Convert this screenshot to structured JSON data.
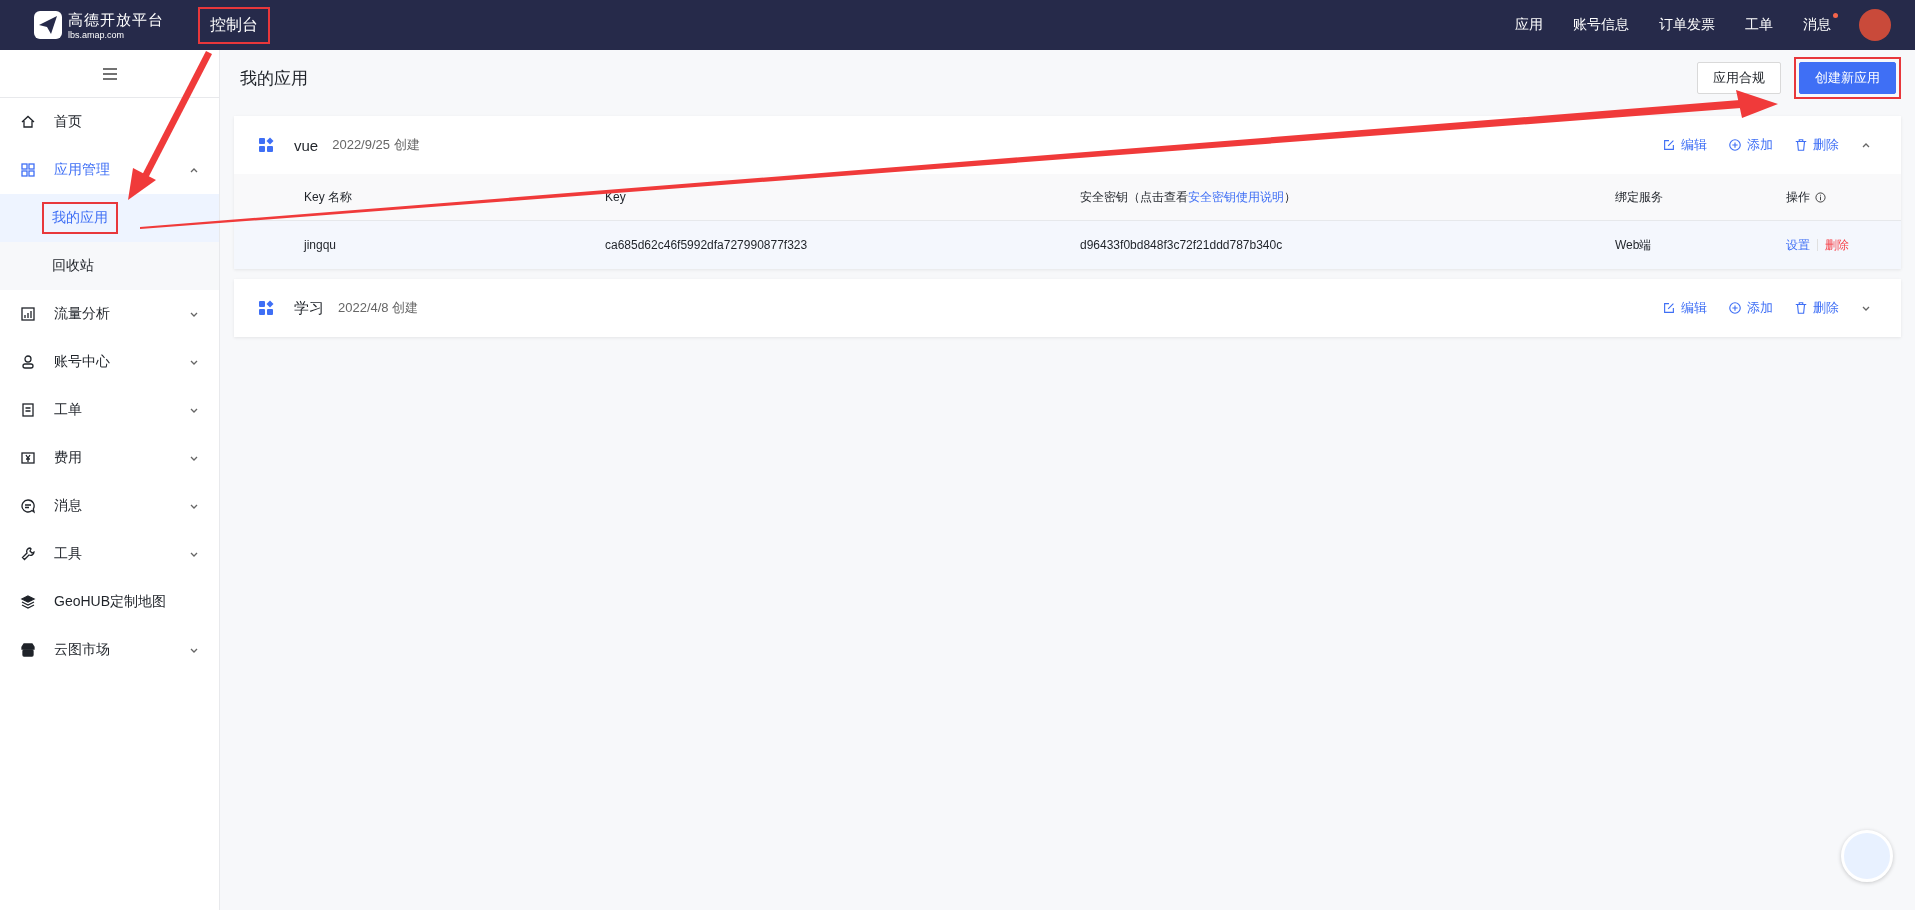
{
  "header": {
    "logo_title": "高德开放平台",
    "logo_subtitle": "lbs.amap.com",
    "console": {
      "label": "控制台",
      "highlighted": true
    },
    "nav": [
      {
        "label": "应用"
      },
      {
        "label": "账号信息"
      },
      {
        "label": "订单发票"
      },
      {
        "label": "工单"
      },
      {
        "label": "消息",
        "badge": true
      }
    ]
  },
  "sidebar": {
    "items": [
      {
        "label": "首页",
        "kind": "link",
        "selected": false
      },
      {
        "label": "应用管理",
        "kind": "group",
        "selected": true,
        "expanded": true,
        "children": [
          {
            "label": "我的应用",
            "selected": true,
            "highlighted": true
          },
          {
            "label": "回收站",
            "selected": false,
            "highlighted": false
          }
        ]
      },
      {
        "label": "流量分析",
        "kind": "group",
        "selected": false,
        "expanded": false
      },
      {
        "label": "账号中心",
        "kind": "group",
        "selected": false,
        "expanded": false
      },
      {
        "label": "工单",
        "kind": "group",
        "selected": false,
        "expanded": false
      },
      {
        "label": "费用",
        "kind": "group",
        "selected": false,
        "expanded": false
      },
      {
        "label": "消息",
        "kind": "group",
        "selected": false,
        "expanded": false
      },
      {
        "label": "工具",
        "kind": "group",
        "selected": false,
        "expanded": false
      },
      {
        "label": "GeoHUB定制地图",
        "kind": "link",
        "selected": false
      },
      {
        "label": "云图市场",
        "kind": "group",
        "selected": false,
        "expanded": false
      }
    ]
  },
  "page": {
    "title": "我的应用",
    "buttons": [
      {
        "label": "应用合规",
        "kind": "default",
        "highlighted": false
      },
      {
        "label": "创建新应用",
        "kind": "primary",
        "highlighted": true
      }
    ]
  },
  "apps": [
    {
      "name": "vue",
      "created": "2022/9/25 创建",
      "expanded": true,
      "actions": [
        "编辑",
        "添加",
        "删除"
      ],
      "columns": [
        {
          "label": "Key 名称"
        },
        {
          "label": "Key"
        },
        {
          "label": "安全密钥（点击查看",
          "link": "安全密钥使用说明",
          "suffix": "）"
        },
        {
          "label": "绑定服务"
        },
        {
          "label": "操作",
          "info": true
        }
      ],
      "rows": [
        {
          "name": "jingqu",
          "key": "ca685d62c46f5992dfa727990877f323",
          "secret": "d96433f0bd848f3c72f21ddd787b340c",
          "service": "Web端",
          "actions": [
            {
              "label": "设置",
              "kind": "link"
            },
            {
              "label": "删除",
              "kind": "danger"
            }
          ]
        }
      ]
    },
    {
      "name": "学习",
      "created": "2022/4/8 创建",
      "expanded": false,
      "actions": [
        "编辑",
        "添加",
        "删除"
      ]
    }
  ]
}
